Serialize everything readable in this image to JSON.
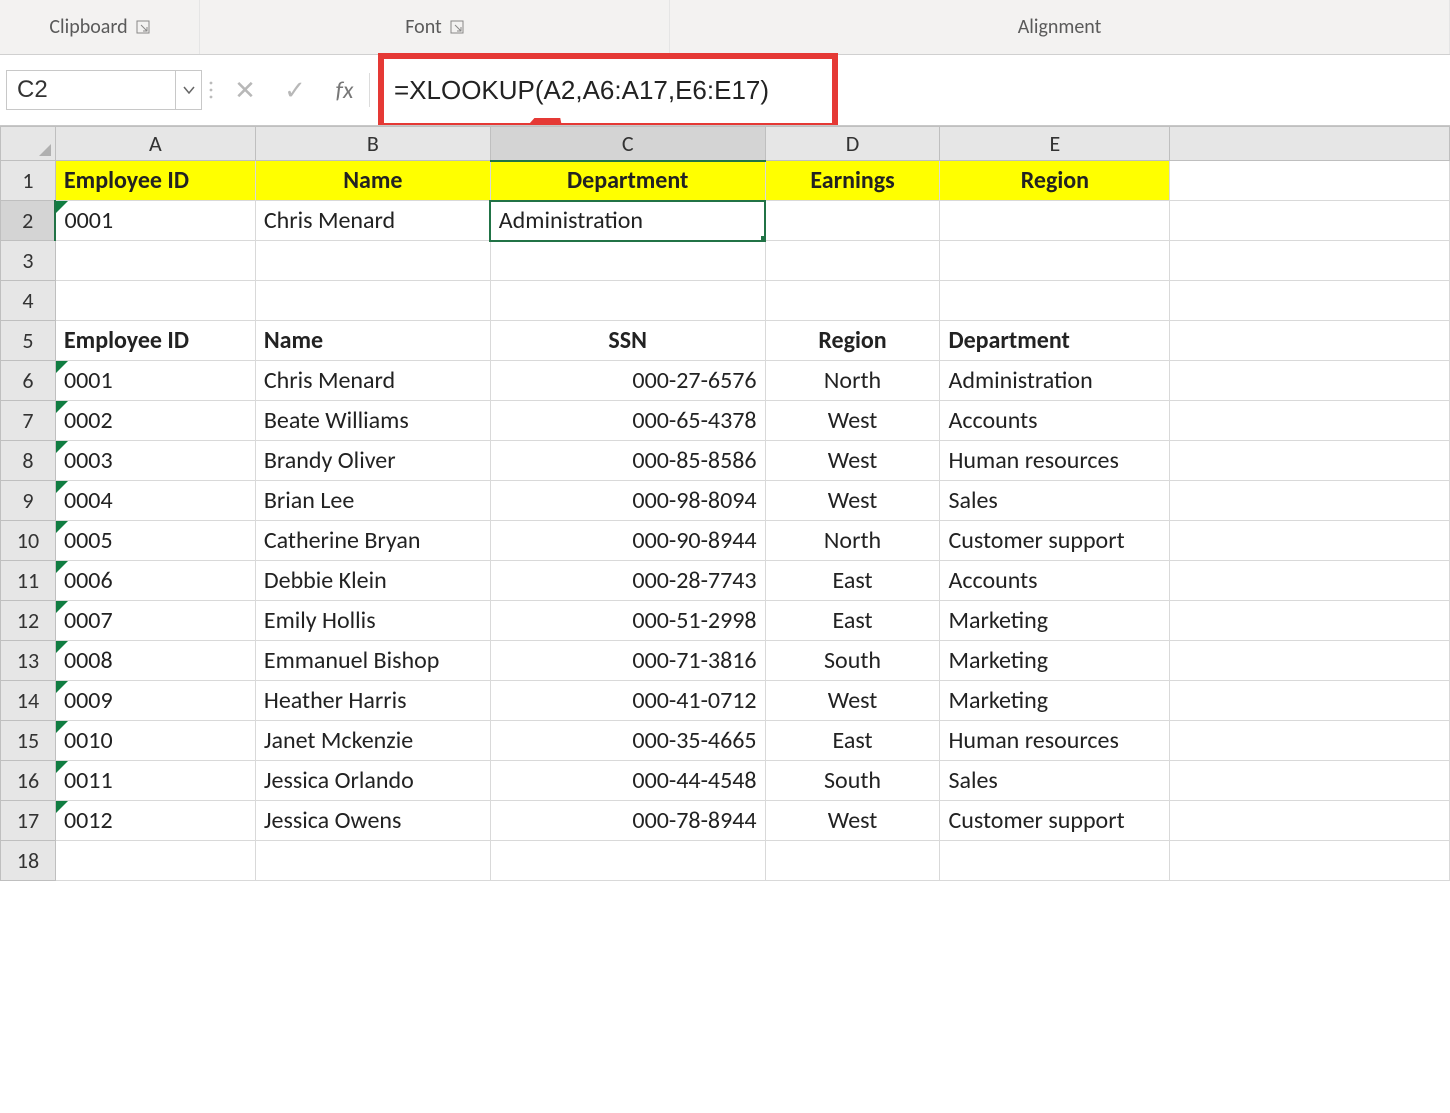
{
  "ribbon": {
    "groups": {
      "clipboard": "Clipboard",
      "font": "Font",
      "alignment": "Alignment"
    }
  },
  "formula_bar": {
    "name_box": "C2",
    "fx_label": "fx",
    "formula": "=XLOOKUP(A2,A6:A17,E6:E17)"
  },
  "columns": [
    "A",
    "B",
    "C",
    "D",
    "E"
  ],
  "row_numbers": [
    "1",
    "2",
    "3",
    "4",
    "5",
    "6",
    "7",
    "8",
    "9",
    "10",
    "11",
    "12",
    "13",
    "14",
    "15",
    "16",
    "17",
    "18"
  ],
  "header_row": {
    "A": "Employee ID",
    "B": "Name",
    "C": "Department",
    "D": "Earnings",
    "E": "Region"
  },
  "result_row": {
    "A": "0001",
    "B": "Chris Menard",
    "C": "Administration",
    "D": "",
    "E": ""
  },
  "table2_header": {
    "A": "Employee ID",
    "B": "Name",
    "C": "SSN",
    "D": "Region",
    "E": "Department"
  },
  "table2_rows": [
    {
      "A": "0001",
      "B": "Chris Menard",
      "C": "000-27-6576",
      "D": "North",
      "E": "Administration"
    },
    {
      "A": "0002",
      "B": "Beate Williams",
      "C": "000-65-4378",
      "D": "West",
      "E": "Accounts"
    },
    {
      "A": "0003",
      "B": "Brandy Oliver",
      "C": "000-85-8586",
      "D": "West",
      "E": "Human resources"
    },
    {
      "A": "0004",
      "B": "Brian Lee",
      "C": "000-98-8094",
      "D": "West",
      "E": "Sales"
    },
    {
      "A": "0005",
      "B": "Catherine Bryan",
      "C": "000-90-8944",
      "D": "North",
      "E": "Customer support"
    },
    {
      "A": "0006",
      "B": "Debbie Klein",
      "C": "000-28-7743",
      "D": "East",
      "E": "Accounts"
    },
    {
      "A": "0007",
      "B": "Emily Hollis",
      "C": "000-51-2998",
      "D": "East",
      "E": "Marketing"
    },
    {
      "A": "0008",
      "B": "Emmanuel Bishop",
      "C": "000-71-3816",
      "D": "South",
      "E": "Marketing"
    },
    {
      "A": "0009",
      "B": "Heather Harris",
      "C": "000-41-0712",
      "D": "West",
      "E": "Marketing"
    },
    {
      "A": "0010",
      "B": "Janet Mckenzie",
      "C": "000-35-4665",
      "D": "East",
      "E": "Human resources"
    },
    {
      "A": "0011",
      "B": "Jessica Orlando",
      "C": "000-44-4548",
      "D": "South",
      "E": "Sales"
    },
    {
      "A": "0012",
      "B": "Jessica Owens",
      "C": "000-78-8944",
      "D": "West",
      "E": "Customer support"
    }
  ],
  "chart_data": {
    "type": "table",
    "title": "Employee lookup with XLOOKUP",
    "formula": "=XLOOKUP(A2,A6:A17,E6:E17)",
    "lookup_result": {
      "Employee ID": "0001",
      "Name": "Chris Menard",
      "Department": "Administration"
    },
    "columns": [
      "Employee ID",
      "Name",
      "SSN",
      "Region",
      "Department"
    ],
    "rows": [
      [
        "0001",
        "Chris Menard",
        "000-27-6576",
        "North",
        "Administration"
      ],
      [
        "0002",
        "Beate Williams",
        "000-65-4378",
        "West",
        "Accounts"
      ],
      [
        "0003",
        "Brandy Oliver",
        "000-85-8586",
        "West",
        "Human resources"
      ],
      [
        "0004",
        "Brian Lee",
        "000-98-8094",
        "West",
        "Sales"
      ],
      [
        "0005",
        "Catherine Bryan",
        "000-90-8944",
        "North",
        "Customer support"
      ],
      [
        "0006",
        "Debbie Klein",
        "000-28-7743",
        "East",
        "Accounts"
      ],
      [
        "0007",
        "Emily Hollis",
        "000-51-2998",
        "East",
        "Marketing"
      ],
      [
        "0008",
        "Emmanuel Bishop",
        "000-71-3816",
        "South",
        "Marketing"
      ],
      [
        "0009",
        "Heather Harris",
        "000-41-0712",
        "West",
        "Marketing"
      ],
      [
        "0010",
        "Janet Mckenzie",
        "000-35-4665",
        "East",
        "Human resources"
      ],
      [
        "0011",
        "Jessica Orlando",
        "000-44-4548",
        "South",
        "Sales"
      ],
      [
        "0012",
        "Jessica Owens",
        "000-78-8944",
        "West",
        "Customer support"
      ]
    ]
  }
}
